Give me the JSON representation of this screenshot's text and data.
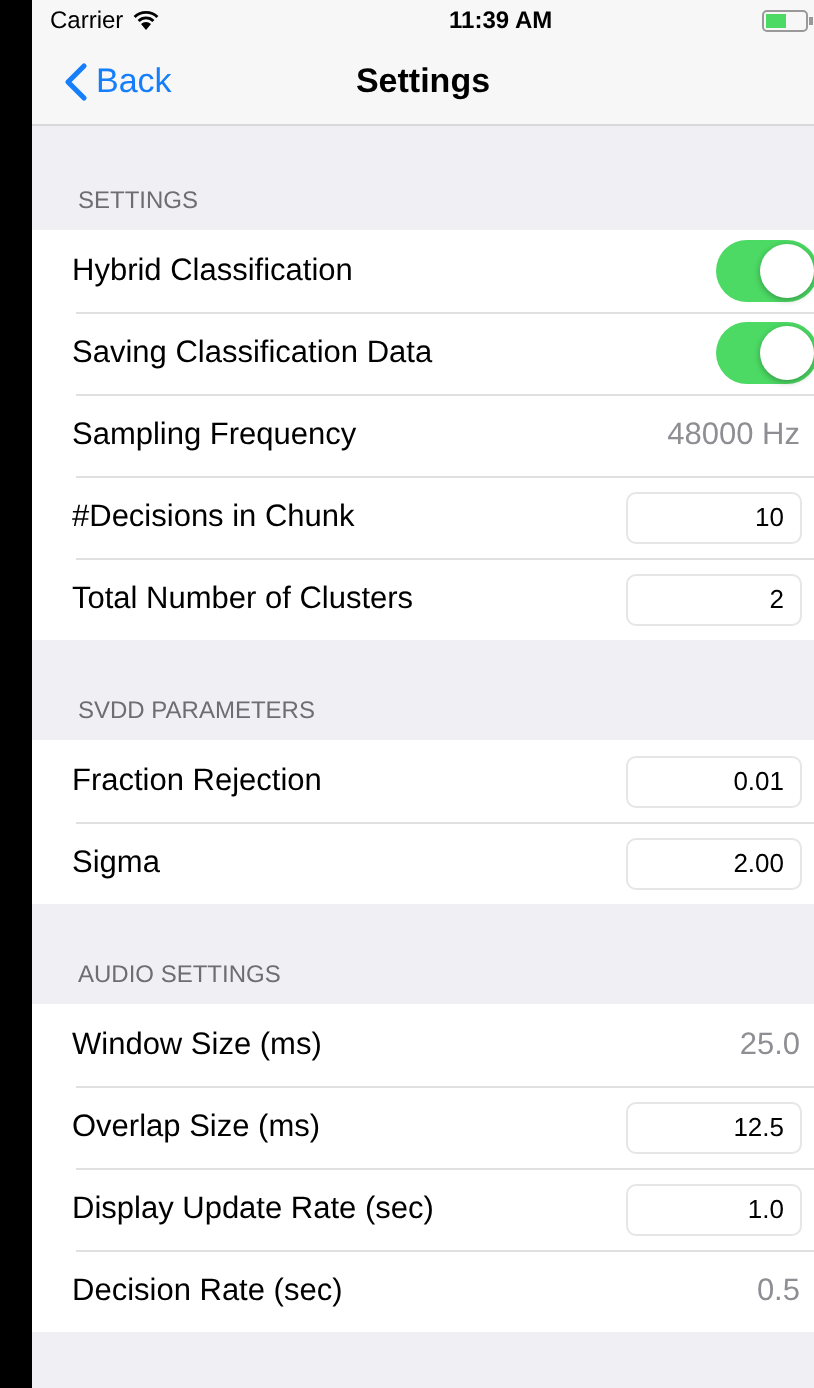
{
  "status_bar": {
    "carrier": "Carrier",
    "time": "11:39 AM"
  },
  "nav": {
    "back": "Back",
    "title": "Settings"
  },
  "sections": [
    {
      "header": "SETTINGS",
      "rows": [
        {
          "kind": "toggle",
          "label": "Hybrid Classification",
          "on": true
        },
        {
          "kind": "toggle",
          "label": "Saving Classification Data",
          "on": true
        },
        {
          "kind": "value",
          "label": "Sampling Frequency",
          "value": "48000 Hz"
        },
        {
          "kind": "field",
          "label": "#Decisions in Chunk",
          "value": "10"
        },
        {
          "kind": "field",
          "label": "Total Number of Clusters",
          "value": "2"
        }
      ]
    },
    {
      "header": "SVDD PARAMETERS",
      "rows": [
        {
          "kind": "field",
          "label": "Fraction Rejection",
          "value": "0.01"
        },
        {
          "kind": "field",
          "label": "Sigma",
          "value": "2.00"
        }
      ]
    },
    {
      "header": "AUDIO SETTINGS",
      "rows": [
        {
          "kind": "value",
          "label": "Window Size (ms)",
          "value": "25.0"
        },
        {
          "kind": "field",
          "label": "Overlap Size (ms)",
          "value": "12.5"
        },
        {
          "kind": "field",
          "label": "Display Update Rate (sec)",
          "value": "1.0"
        },
        {
          "kind": "value",
          "label": "Decision Rate (sec)",
          "value": "0.5"
        }
      ]
    }
  ]
}
